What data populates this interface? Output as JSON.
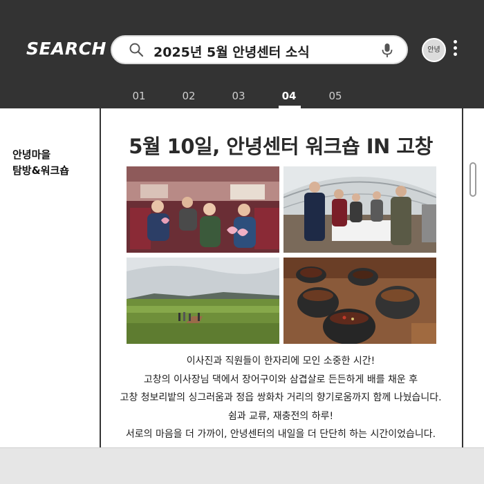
{
  "header": {
    "logo": "SEARCH",
    "search_query": "2025년 5월 안녕센터 소식",
    "avatar_label": "안녕",
    "tabs": [
      "01",
      "02",
      "03",
      "04",
      "05"
    ],
    "active_tab": "04"
  },
  "sidebar": {
    "title_line1": "안녕마을",
    "title_line2": "탐방&워크숍"
  },
  "post": {
    "title": "5월 10일, 안녕센터 워크숍 IN 고창",
    "photos": [
      "bus-group-photo",
      "greenhouse-lunch-photo",
      "barley-field-photo",
      "mugwort-tea-photo"
    ],
    "lines": [
      "이사진과 직원들이 한자리에 모인 소중한 시간!",
      "고창의 이사장님 댁에서 장어구이와 삼겹살로 든든하게 배를 채운 후",
      "고창 청보리밭의 싱그러움과 정읍 쌍화차 거리의 향기로움까지 함께 나눴습니다.",
      "쉼과 교류, 재충전의 하루!",
      "서로의 마음을 더 가까이, 안녕센터의 내일을 더 단단히 하는 시간이었습니다."
    ]
  },
  "colors": {
    "header_bg": "#333333",
    "page_bg": "#ffffff",
    "accent_white": "#ffffff"
  }
}
